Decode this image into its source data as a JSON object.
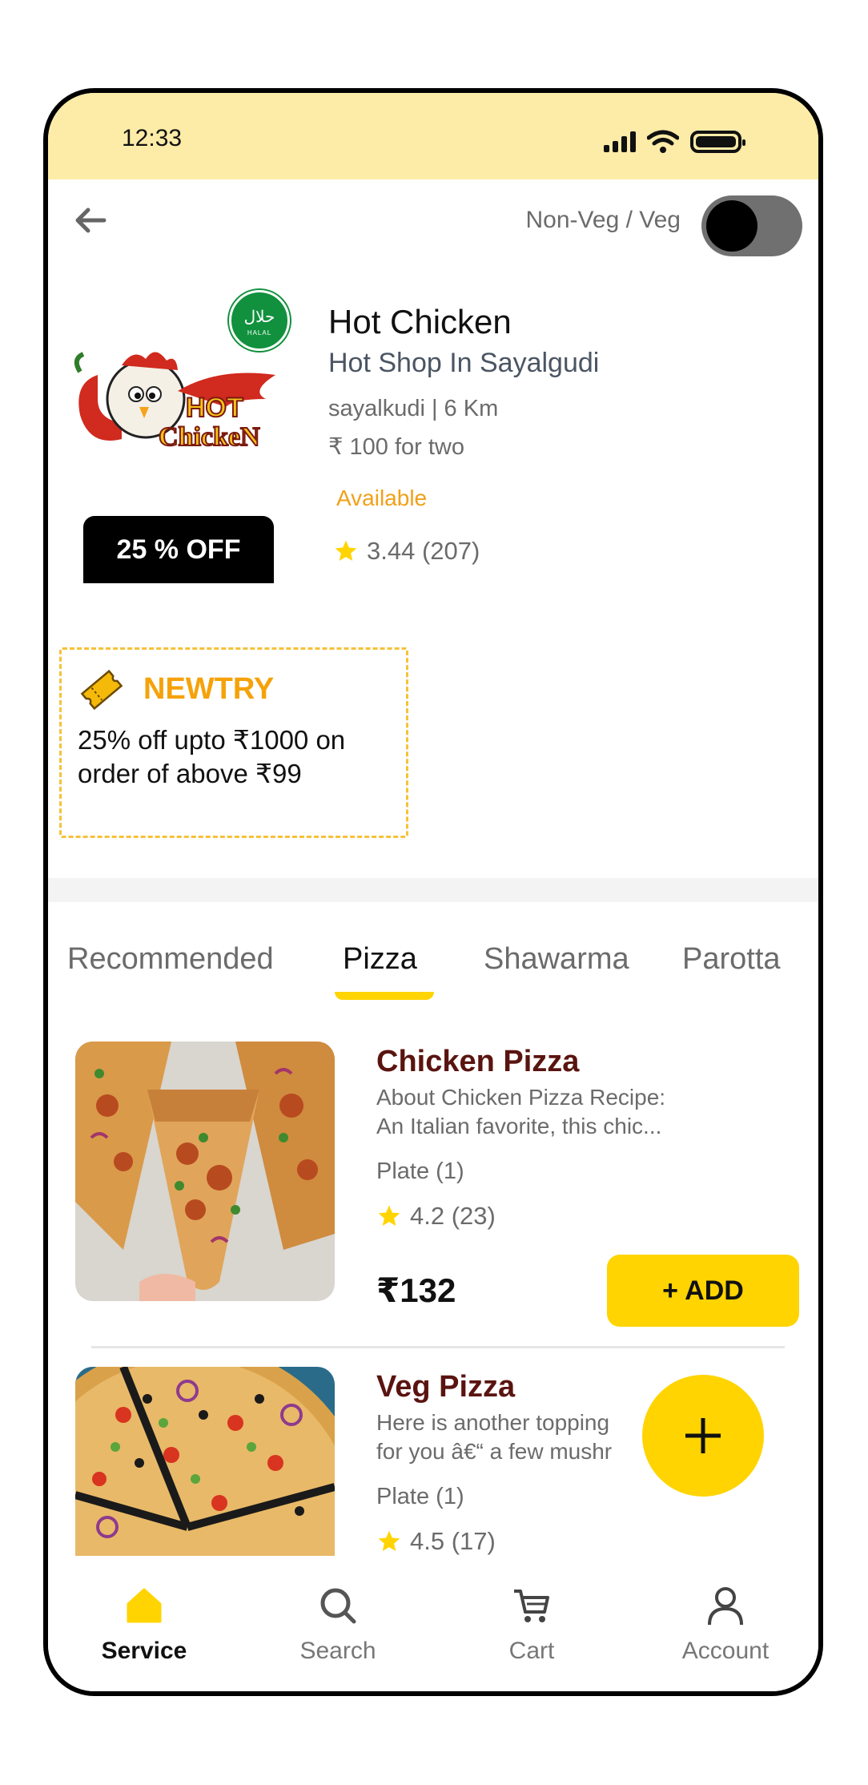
{
  "status_bar": {
    "time": "12:33"
  },
  "topbar": {
    "toggle_label": "Non-Veg / Veg"
  },
  "shop": {
    "name": "Hot Chicken",
    "subtitle": "Hot Shop In Sayalgudi",
    "location": "sayalkudi | 6 Km",
    "price_for_two": "₹ 100 for two",
    "availability": "Available",
    "rating": "3.44 (207)",
    "discount_badge": "25 % OFF",
    "halal_badge": {
      "arabic": "حلال",
      "text": "HALAL"
    },
    "logo": {
      "line1": "HOT",
      "line2": "ChickeN"
    }
  },
  "coupon": {
    "code": "NEWTRY",
    "description": "25% off upto ₹1000 on order of above ₹99"
  },
  "tabs": [
    {
      "label": "Recommended",
      "active": false
    },
    {
      "label": "Pizza",
      "active": true
    },
    {
      "label": "Shawarma",
      "active": false
    },
    {
      "label": "Parotta",
      "active": false
    }
  ],
  "items": [
    {
      "title": "Chicken Pizza",
      "desc_line1": "About Chicken Pizza Recipe:",
      "desc_line2": "An Italian favorite, this chic...",
      "qty": "Plate (1)",
      "rating": "4.2 (23)",
      "price": "₹132",
      "add_label": "+ ADD"
    },
    {
      "title": "Veg Pizza",
      "desc_line1": " Here is another topping",
      "desc_line2": "for you â€“ a few mushr",
      "qty": "Plate (1)",
      "rating": "4.5 (17)"
    }
  ],
  "bottom_nav": [
    {
      "label": "Service",
      "icon": "home-icon",
      "active": true
    },
    {
      "label": "Search",
      "icon": "search-icon",
      "active": false
    },
    {
      "label": "Cart",
      "icon": "cart-icon",
      "active": false
    },
    {
      "label": "Account",
      "icon": "account-icon",
      "active": false
    }
  ],
  "colors": {
    "accent": "#ffd400",
    "status_bar": "#fdeba8",
    "item_title": "#5a1410",
    "available": "#f2a01a",
    "coupon_code": "#f5a20a",
    "halal": "#11913d"
  }
}
